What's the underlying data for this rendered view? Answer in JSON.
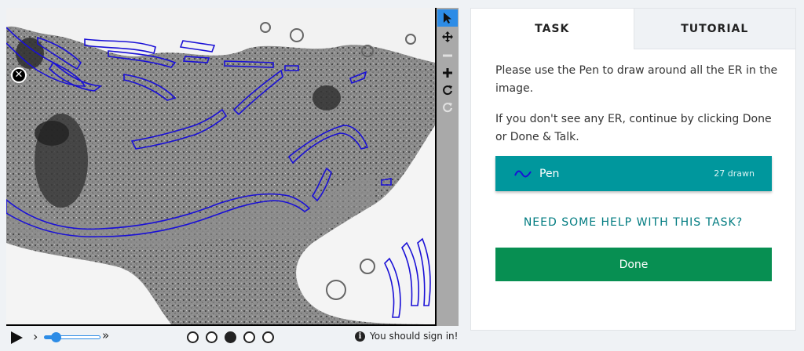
{
  "toolbar": {
    "tools": [
      {
        "name": "select-tool",
        "icon": "cursor-icon",
        "active": true
      },
      {
        "name": "move-tool",
        "icon": "move-arrows-icon",
        "active": false
      },
      {
        "name": "zoom-out-tool",
        "icon": "minus-icon",
        "active": false,
        "disabled": true
      },
      {
        "name": "zoom-in-tool",
        "icon": "plus-icon",
        "active": false
      },
      {
        "name": "rotate-tool",
        "icon": "rotate-icon",
        "active": false
      },
      {
        "name": "reset-tool",
        "icon": "refresh-icon",
        "active": false,
        "disabled": true
      }
    ]
  },
  "playback": {
    "play_icon": "play-icon",
    "step_back": "›",
    "step_forward": "»",
    "speed_level": 0.2,
    "frames": 5,
    "current_frame": 3,
    "signin_text": "You should sign in!"
  },
  "tabs": {
    "task": "TASK",
    "tutorial": "TUTORIAL"
  },
  "task": {
    "instruction_1": "Please use the Pen to draw around all the ER in the image.",
    "instruction_2": "If you don't see any ER, continue by clicking Done or Done & Talk.",
    "tool_label": "Pen",
    "tool_count": "27 drawn",
    "help_link": "NEED SOME HELP WITH THIS TASK?",
    "done_label": "Done"
  },
  "colors": {
    "accent_blue": "#2d8ce6",
    "teal": "#00979d",
    "green": "#078f52",
    "annotation": "#1a10d6"
  }
}
